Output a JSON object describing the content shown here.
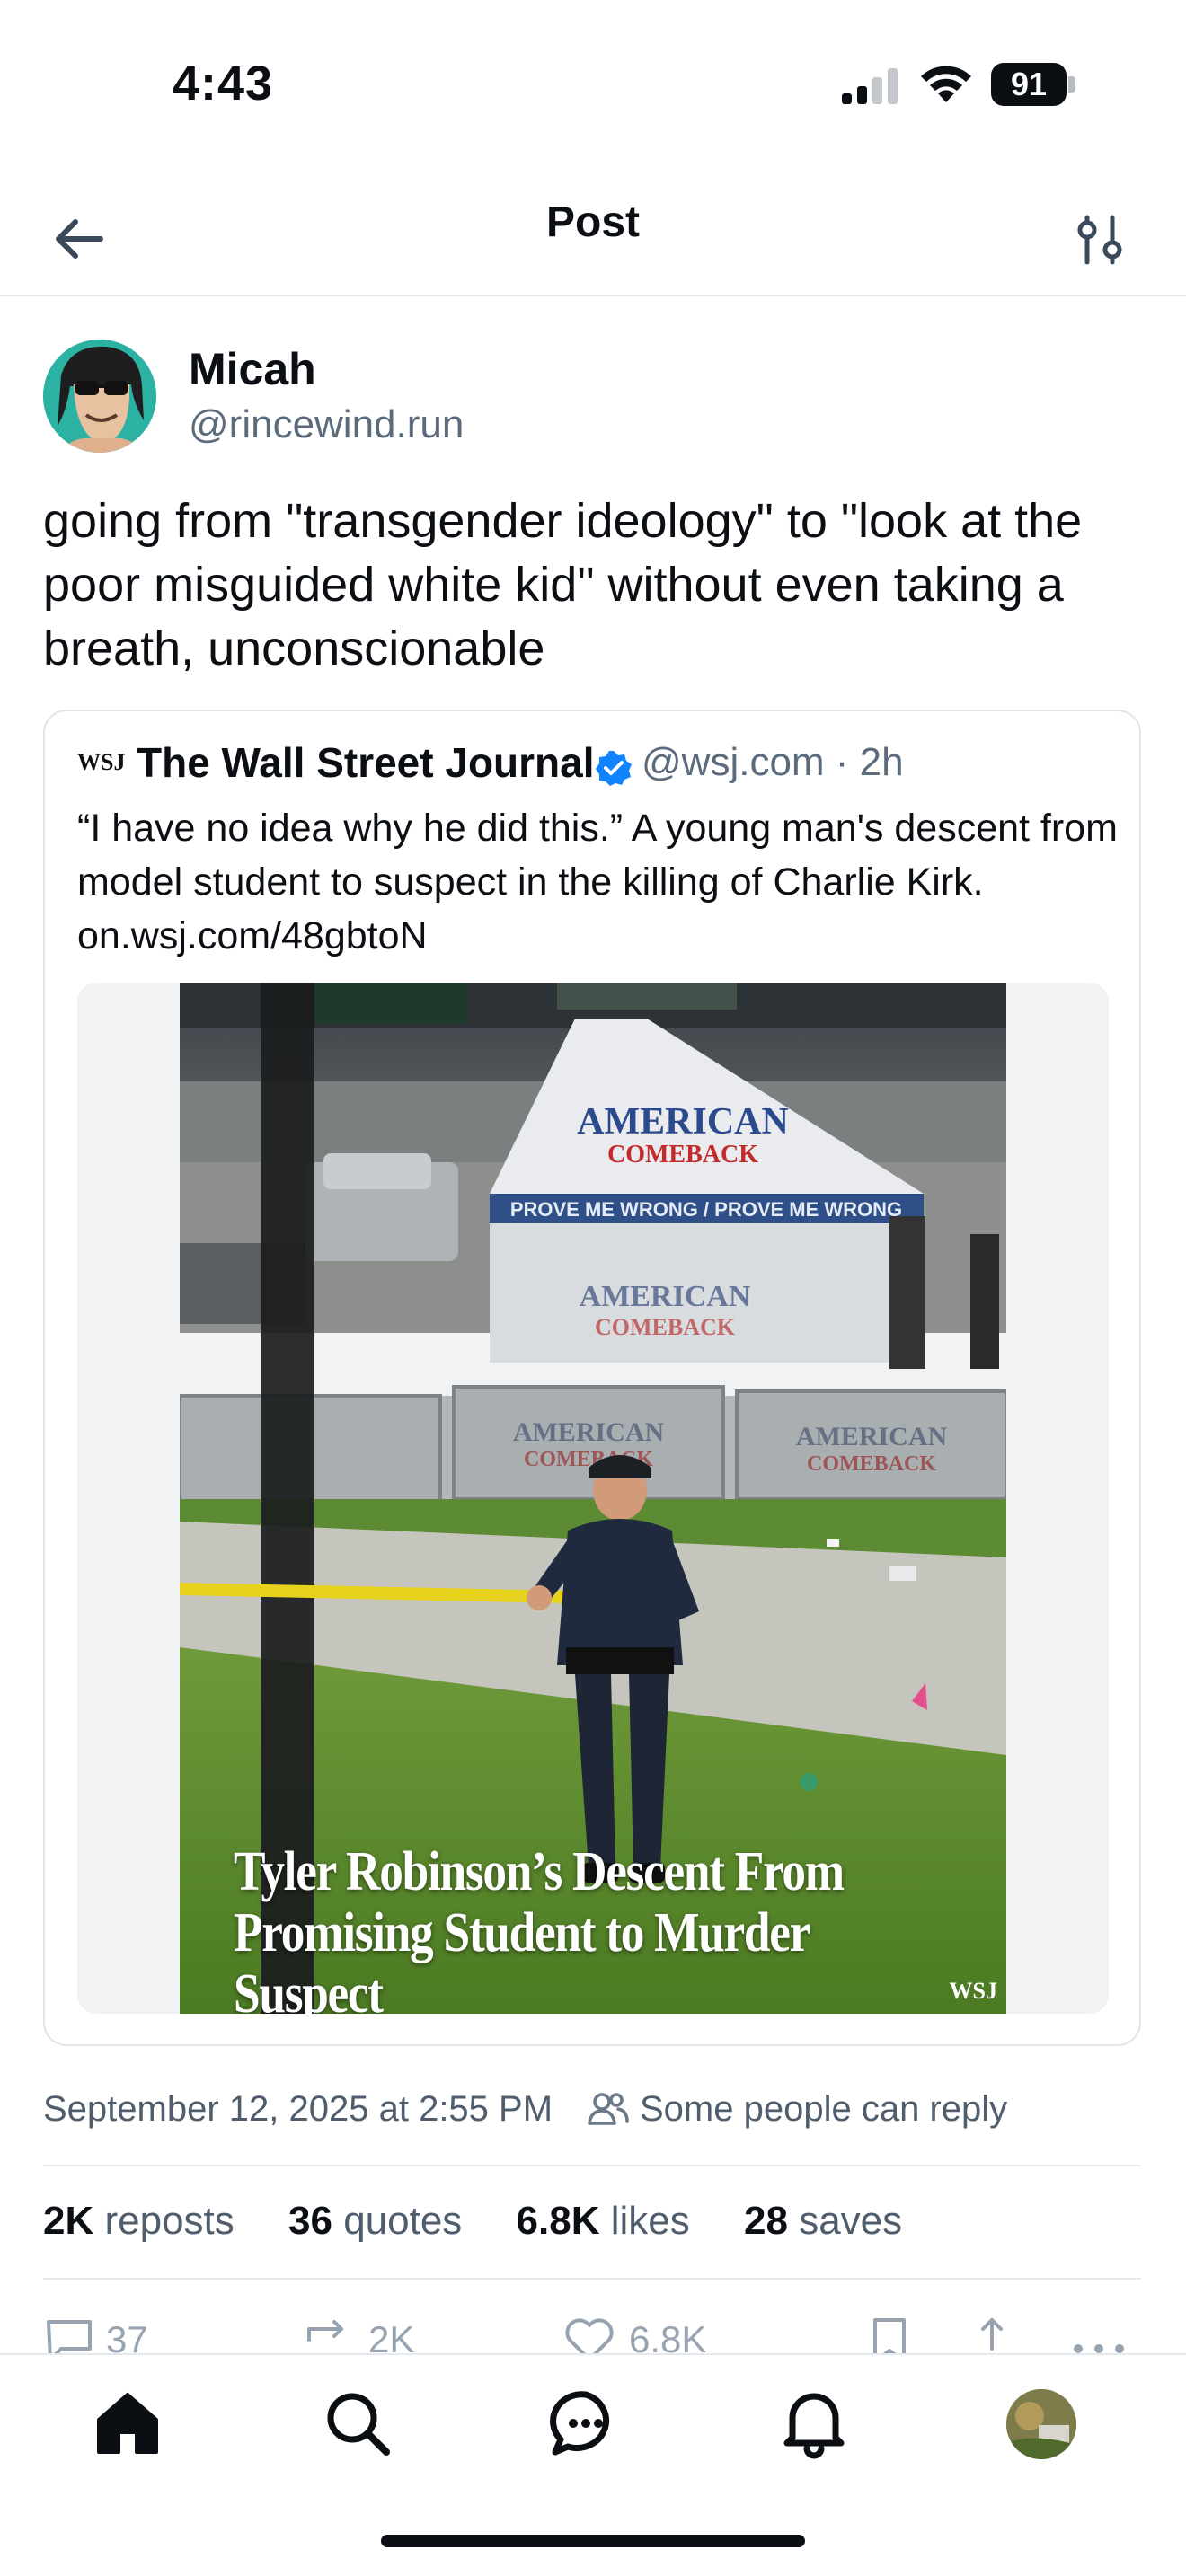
{
  "status_bar": {
    "time": "4:43",
    "battery": "91"
  },
  "header": {
    "title": "Post"
  },
  "post": {
    "author_name": "Micah",
    "author_handle": "@rincewind.run",
    "text": "going from \"transgender ideology\" to \"look at the poor misguided white kid\" without even taking a breath, unconscionable",
    "date": "September 12, 2025 at 2:55 PM",
    "reply_setting": "Some people can reply"
  },
  "quote": {
    "avatar_label": "WSJ",
    "author_name": "The Wall Street Journal",
    "handle_time": "@wsj.com · 2h",
    "text": "“I have no idea why he did this.” A young man's descent from model student to suspect in the killing of Charlie Kirk. on.wsj.com/48gbtoN",
    "image_headline": "Tyler Robinson’s Descent From Promising Student to Murder Suspect",
    "image_watermark": "WSJ",
    "tent_brand_top": "AMERICAN",
    "tent_brand_bottom": "COMEBACK",
    "banner_text": "PROVE ME WRONG / PROVE ME WRONG"
  },
  "stats": {
    "reposts_count": "2K",
    "reposts_label": "reposts",
    "quotes_count": "36",
    "quotes_label": "quotes",
    "likes_count": "6.8K",
    "likes_label": "likes",
    "saves_count": "28",
    "saves_label": "saves"
  },
  "actions": {
    "reply_count": "37",
    "repost_count": "2K",
    "like_count": "6.8K"
  },
  "nav": {
    "items": [
      "home-icon",
      "search-icon",
      "chat-icon",
      "notifications-icon",
      "profile-avatar"
    ]
  },
  "colors": {
    "accent": "#1083fe",
    "text_secondary": "#5b6b7c",
    "divider": "#e6e9ec"
  }
}
